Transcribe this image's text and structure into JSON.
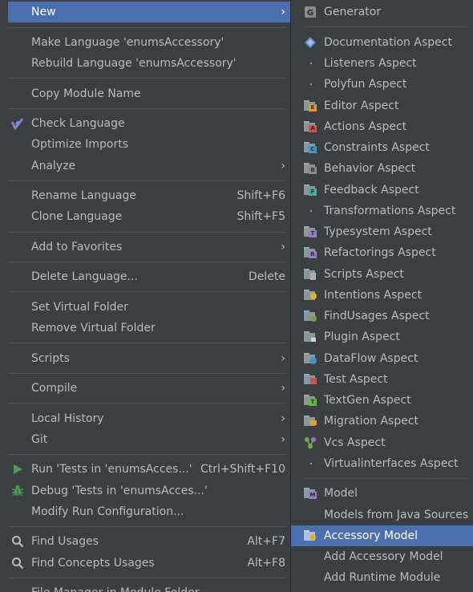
{
  "menu": {
    "new": {
      "label": "New",
      "icon": "none"
    },
    "make_language": {
      "label": "Make Language 'enumsAccessory'"
    },
    "rebuild_language": {
      "label": "Rebuild Language 'enumsAccessory'"
    },
    "copy_module_name": {
      "label": "Copy Module Name"
    },
    "check_language": {
      "label": "Check Language",
      "icon": "check-language-icon"
    },
    "optimize_imports": {
      "label": "Optimize Imports"
    },
    "analyze": {
      "label": "Analyze"
    },
    "rename_language": {
      "label": "Rename Language",
      "shortcut": "Shift+F6"
    },
    "clone_language": {
      "label": "Clone Language",
      "shortcut": "Shift+F5"
    },
    "add_to_favorites": {
      "label": "Add to Favorites"
    },
    "delete_language": {
      "label": "Delete Language...",
      "shortcut": "Delete"
    },
    "set_virtual_folder": {
      "label": "Set Virtual Folder"
    },
    "remove_virtual_folder": {
      "label": "Remove Virtual Folder"
    },
    "scripts": {
      "label": "Scripts"
    },
    "compile": {
      "label": "Compile"
    },
    "local_history": {
      "label": "Local History"
    },
    "git": {
      "label": "Git"
    },
    "run_tests": {
      "label": "Run 'Tests in 'enumsAcces...'",
      "shortcut": "Ctrl+Shift+F10",
      "icon": "run-icon"
    },
    "debug_tests": {
      "label": "Debug 'Tests in 'enumsAcces...'",
      "icon": "debug-icon"
    },
    "modify_run_config": {
      "label": "Modify Run Configuration..."
    },
    "find_usages": {
      "label": "Find Usages",
      "shortcut": "Alt+F7",
      "icon": "search-icon"
    },
    "find_concepts_usages": {
      "label": "Find Concepts Usages",
      "shortcut": "Alt+F8",
      "icon": "search-icon"
    },
    "file_manager": {
      "label": "File Manager in Module Folder"
    }
  },
  "submenu": {
    "generator": {
      "label": "Generator",
      "icon": "generator-icon"
    },
    "documentation": {
      "label": "Documentation Aspect",
      "icon": "documentation-icon"
    },
    "listeners": {
      "label": "Listeners Aspect"
    },
    "polyfun": {
      "label": "Polyfun Aspect"
    },
    "editor": {
      "label": "Editor Aspect",
      "icon": "editor-aspect-icon",
      "badge": "E",
      "color": "#d99a3b"
    },
    "actions": {
      "label": "Actions Aspect",
      "icon": "actions-aspect-icon",
      "badge": "A",
      "color": "#c75450"
    },
    "constraints": {
      "label": "Constraints Aspect",
      "icon": "constraints-aspect-icon",
      "badge": "C",
      "color": "#3f97c2"
    },
    "behavior": {
      "label": "Behavior Aspect",
      "icon": "behavior-aspect-icon",
      "badge": "B",
      "color": "#8a8a8a"
    },
    "feedback": {
      "label": "Feedback Aspect",
      "icon": "feedback-aspect-icon",
      "badge": "F",
      "color": "#4aa8a0"
    },
    "transformations": {
      "label": "Transformations Aspect"
    },
    "typesystem": {
      "label": "Typesystem Aspect",
      "icon": "typesystem-aspect-icon",
      "badge": "T",
      "color": "#9a7cc4"
    },
    "refactorings": {
      "label": "Refactorings Aspect",
      "icon": "refactorings-aspect-icon",
      "badge": "R",
      "color": "#9a7cc4"
    },
    "scripts": {
      "label": "Scripts Aspect",
      "icon": "scripts-aspect-icon",
      "badge": "",
      "color": "#8a8a8a"
    },
    "intentions": {
      "label": "Intentions Aspect",
      "icon": "intentions-aspect-icon",
      "badge": "",
      "color": "#e0b030"
    },
    "findusages": {
      "label": "FindUsages Aspect",
      "icon": "findusages-aspect-icon",
      "badge": "",
      "color": "#7ca04a"
    },
    "plugin": {
      "label": "Plugin Aspect",
      "icon": "plugin-aspect-icon",
      "badge": "",
      "color": "#d8d8d8"
    },
    "dataflow": {
      "label": "DataFlow Aspect",
      "icon": "dataflow-aspect-icon",
      "badge": "",
      "color": "#3f97c2"
    },
    "test": {
      "label": "Test Aspect",
      "icon": "test-aspect-icon",
      "badge": "",
      "color": "#c75450"
    },
    "textgen": {
      "label": "TextGen Aspect",
      "icon": "textgen-aspect-icon",
      "badge": "T",
      "color": "#62b543"
    },
    "migration": {
      "label": "Migration Aspect",
      "icon": "migration-aspect-icon",
      "badge": "",
      "color": "#e0a030"
    },
    "vcs": {
      "label": "Vcs Aspect",
      "icon": "vcs-icon"
    },
    "virtualinterfaces": {
      "label": "Virtualinterfaces Aspect"
    },
    "model": {
      "label": "Model",
      "icon": "model-icon",
      "badge": "M",
      "color": "#9a7cc4"
    },
    "models_from_java": {
      "label": "Models from Java Sources"
    },
    "accessory_model": {
      "label": "Accessory Model",
      "icon": "accessory-model-icon",
      "selected": true
    },
    "add_accessory_model": {
      "label": "Add Accessory Model"
    },
    "add_runtime_module": {
      "label": "Add Runtime Module"
    }
  },
  "colors": {
    "background": "#3c3f41",
    "selection": "#4b6eaf",
    "text": "#bbbbbb",
    "separator": "#515151"
  }
}
